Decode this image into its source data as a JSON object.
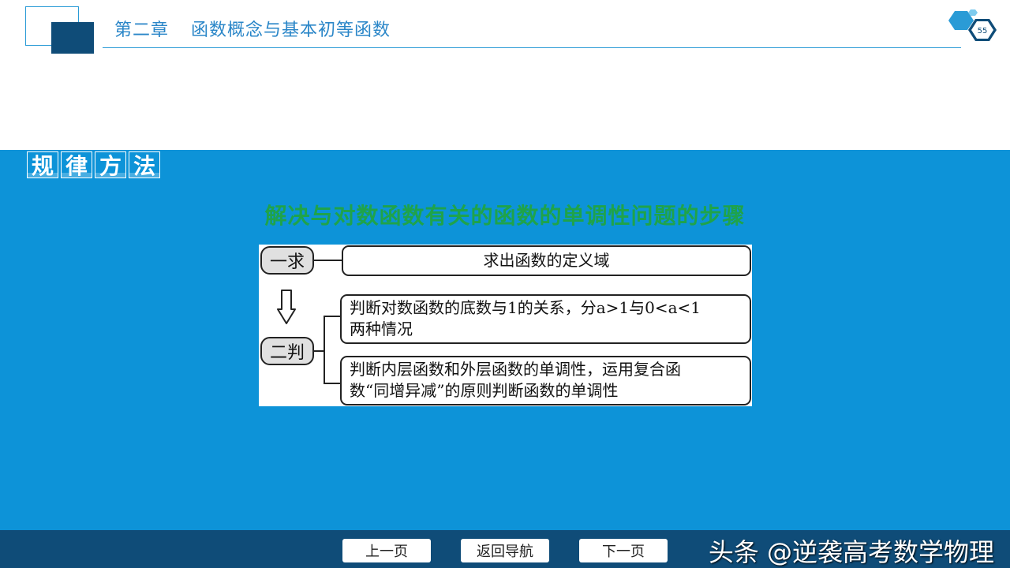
{
  "header": {
    "chapter": "第二章",
    "title": "函数概念与基本初等函数"
  },
  "section_tag": [
    "规",
    "律",
    "方",
    "法"
  ],
  "subtitle": "解决与对数函数有关的函数的单调性问题的步骤",
  "diagram": {
    "step1_label": "一求",
    "step1_text": "求出函数的定义域",
    "step2_label": "二判",
    "step2_line1": "判断对数函数的底数与1的关系，分a>1与0<a<1",
    "step2_line2": "两种情况",
    "step3_line1": "判断内层函数和外层函数的单调性，运用复合函",
    "step3_line2": "数“同增异减”的原则判断函数的单调性"
  },
  "footer": {
    "prev": "上一页",
    "back": "返回导航",
    "next": "下一页",
    "watermark": "头条 @逆袭高考数学物理"
  },
  "colors": {
    "primary_blue": "#0d93d8",
    "navy": "#0f4c78",
    "header_text": "#2a86c8",
    "subtitle_green": "#1fa34a"
  }
}
